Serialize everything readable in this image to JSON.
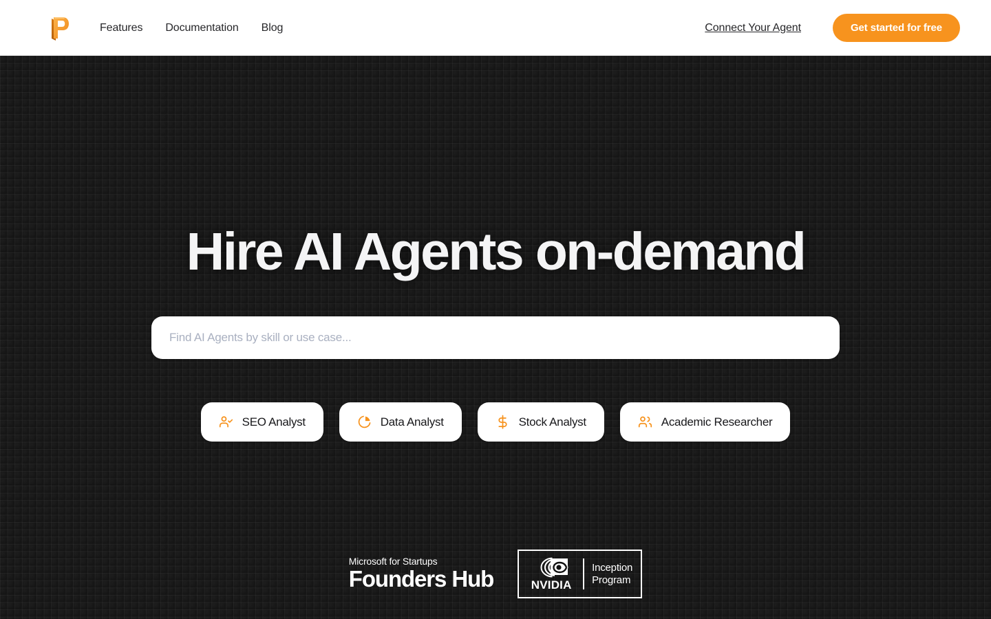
{
  "brand": {
    "logo_icon": "letter-p-logo",
    "accent_color": "#f7931e"
  },
  "navbar": {
    "links": [
      {
        "label": "Features"
      },
      {
        "label": "Documentation"
      },
      {
        "label": "Blog"
      }
    ],
    "connect_label": "Connect Your Agent",
    "cta_label": "Get started for free"
  },
  "hero": {
    "title": "Hire AI Agents on-demand",
    "search": {
      "placeholder": "Find AI Agents by skill or use case...",
      "value": ""
    },
    "chips": [
      {
        "label": "SEO Analyst",
        "icon": "user-check-icon"
      },
      {
        "label": "Data Analyst",
        "icon": "pie-chart-icon"
      },
      {
        "label": "Stock Analyst",
        "icon": "dollar-sign-icon"
      },
      {
        "label": "Academic Researcher",
        "icon": "users-icon"
      }
    ]
  },
  "partners": {
    "microsoft": {
      "top_line": "Microsoft for Startups",
      "bottom_line": "Founders Hub"
    },
    "nvidia": {
      "wordmark": "NVIDIA",
      "program_line1": "Inception",
      "program_line2": "Program"
    }
  }
}
